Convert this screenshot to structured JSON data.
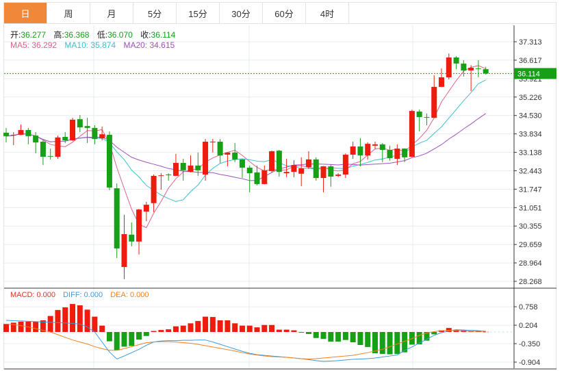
{
  "tabs": [
    {
      "label": "日",
      "active": true
    },
    {
      "label": "周"
    },
    {
      "label": "月"
    },
    {
      "label": "5分"
    },
    {
      "label": "15分"
    },
    {
      "label": "30分"
    },
    {
      "label": "60分"
    },
    {
      "label": "4时"
    }
  ],
  "ohlc_info": {
    "open_label": "开:",
    "open": "36.277",
    "high_label": "高:",
    "high": "36.368",
    "low_label": "低:",
    "low": "36.070",
    "close_label": "收:",
    "close": "36.114"
  },
  "ma_info": {
    "ma5": "MA5: 36.292",
    "ma10": "MA10: 35.874",
    "ma20": "MA20: 34.615"
  },
  "macd_info": {
    "macd": "MACD: 0.000",
    "diff": "DIFF: 0.000",
    "dea": "DEA: 0.000"
  },
  "colors": {
    "up": "#ee1c0e",
    "down": "#16a016",
    "ma5": "#e0608a",
    "ma10": "#3bbfd0",
    "ma20": "#a050c0",
    "macd": "#e03020",
    "diff": "#3a9ad9",
    "dea": "#f08020",
    "active_tab": "#f0883a"
  },
  "chart_data": [
    {
      "type": "candlestick",
      "y_ticks": [
        "37.313",
        "36.617",
        "35.921",
        "35.226",
        "34.530",
        "33.834",
        "33.138",
        "32.443",
        "31.747",
        "31.051",
        "30.355",
        "29.659",
        "28.964",
        "28.268"
      ],
      "ylim": [
        28.268,
        37.313
      ],
      "current_price": "36.114",
      "grid": true,
      "ohlc_fields": [
        "open",
        "high",
        "low",
        "close"
      ],
      "candles": [
        [
          33.88,
          34.06,
          33.51,
          33.75
        ],
        [
          33.79,
          33.9,
          33.41,
          33.8
        ],
        [
          33.8,
          34.19,
          33.78,
          33.98
        ],
        [
          33.98,
          34.06,
          33.44,
          33.75
        ],
        [
          33.77,
          33.9,
          33.1,
          33.51
        ],
        [
          33.54,
          33.59,
          32.66,
          32.97
        ],
        [
          33.0,
          33.28,
          32.87,
          32.98
        ],
        [
          32.97,
          33.77,
          32.89,
          33.7
        ],
        [
          33.72,
          33.9,
          33.49,
          33.59
        ],
        [
          33.59,
          34.44,
          33.57,
          34.37
        ],
        [
          34.39,
          34.55,
          33.9,
          34.08
        ],
        [
          34.13,
          34.44,
          33.49,
          34.06
        ],
        [
          34.06,
          34.16,
          33.44,
          33.64
        ],
        [
          33.67,
          34.11,
          33.59,
          33.82
        ],
        [
          33.8,
          33.93,
          31.71,
          31.81
        ],
        [
          31.78,
          31.96,
          29.15,
          29.51
        ],
        [
          28.81,
          30.78,
          28.35,
          30.05
        ],
        [
          30.03,
          30.49,
          29.59,
          29.77
        ],
        [
          29.77,
          31.0,
          29.28,
          30.98
        ],
        [
          30.9,
          31.27,
          30.54,
          31.16
        ],
        [
          31.22,
          32.3,
          30.88,
          32.25
        ],
        [
          32.25,
          32.35,
          31.73,
          32.27
        ],
        [
          32.3,
          32.35,
          32.07,
          32.28
        ],
        [
          32.25,
          33.08,
          32.24,
          32.74
        ],
        [
          32.74,
          32.89,
          32.07,
          32.46
        ],
        [
          32.4,
          33.02,
          32.38,
          32.64
        ],
        [
          32.64,
          33.13,
          32.25,
          32.46
        ],
        [
          32.3,
          33.64,
          32.07,
          33.54
        ],
        [
          33.52,
          33.64,
          33.13,
          33.54
        ],
        [
          33.54,
          33.64,
          32.74,
          33.02
        ],
        [
          33.05,
          33.14,
          32.61,
          33.13
        ],
        [
          33.13,
          33.49,
          32.77,
          32.87
        ],
        [
          32.87,
          32.89,
          32.17,
          32.56
        ],
        [
          32.56,
          32.64,
          31.63,
          32.35
        ],
        [
          32.38,
          32.64,
          31.89,
          31.94
        ],
        [
          31.94,
          32.64,
          31.93,
          32.46
        ],
        [
          32.43,
          33.2,
          32.38,
          33.18
        ],
        [
          33.2,
          33.23,
          32.22,
          32.4
        ],
        [
          32.35,
          32.89,
          32.2,
          32.4
        ],
        [
          32.4,
          32.84,
          32.2,
          32.66
        ],
        [
          32.33,
          32.95,
          31.86,
          32.53
        ],
        [
          32.58,
          33.18,
          32.51,
          32.87
        ],
        [
          32.87,
          32.95,
          32.07,
          32.17
        ],
        [
          32.17,
          32.62,
          31.63,
          32.61
        ],
        [
          32.61,
          32.69,
          31.84,
          32.22
        ],
        [
          32.25,
          32.35,
          32.2,
          32.3
        ],
        [
          32.3,
          33.1,
          32.17,
          33.05
        ],
        [
          33.05,
          33.54,
          32.89,
          33.36
        ],
        [
          33.36,
          33.67,
          32.61,
          33.02
        ],
        [
          33.02,
          33.52,
          32.87,
          33.46
        ],
        [
          33.39,
          33.54,
          33.26,
          33.44
        ],
        [
          33.44,
          33.49,
          32.77,
          33.23
        ],
        [
          33.23,
          33.39,
          32.82,
          32.92
        ],
        [
          32.89,
          33.44,
          32.66,
          33.28
        ],
        [
          33.28,
          33.29,
          32.77,
          32.95
        ],
        [
          32.97,
          34.75,
          32.96,
          34.7
        ],
        [
          34.68,
          34.75,
          33.93,
          34.47
        ],
        [
          34.47,
          34.6,
          34.16,
          34.46
        ],
        [
          34.44,
          36.05,
          34.43,
          35.61
        ],
        [
          35.61,
          36.31,
          35.6,
          35.97
        ],
        [
          35.97,
          36.87,
          35.89,
          36.72
        ],
        [
          36.72,
          36.77,
          36.28,
          36.49
        ],
        [
          36.49,
          36.62,
          36.0,
          36.23
        ],
        [
          36.23,
          36.43,
          35.45,
          36.33
        ],
        [
          36.31,
          36.62,
          35.97,
          36.3
        ],
        [
          36.277,
          36.368,
          36.07,
          36.114
        ]
      ],
      "moving_averages": [
        "MA5",
        "MA10",
        "MA20"
      ]
    },
    {
      "type": "macd",
      "y_ticks": [
        "0.758",
        "0.204",
        "-0.350",
        "-0.904"
      ],
      "ylim": [
        -1.0,
        0.96
      ],
      "histogram": [
        0.24,
        0.28,
        0.31,
        0.31,
        0.31,
        0.35,
        0.48,
        0.66,
        0.74,
        0.84,
        0.8,
        0.67,
        0.46,
        0.19,
        -0.28,
        -0.55,
        -0.44,
        -0.42,
        -0.23,
        -0.12,
        0.03,
        0.06,
        0.08,
        0.17,
        0.19,
        0.26,
        0.33,
        0.46,
        0.45,
        0.35,
        0.35,
        0.26,
        0.19,
        0.19,
        0.14,
        0.21,
        0.21,
        0.07,
        0.07,
        0.05,
        -0.01,
        -0.06,
        -0.18,
        -0.21,
        -0.29,
        -0.29,
        -0.24,
        -0.31,
        -0.39,
        -0.45,
        -0.64,
        -0.66,
        -0.67,
        -0.66,
        -0.61,
        -0.38,
        -0.37,
        -0.26,
        -0.07,
        0.05,
        0.12,
        0.07,
        0.05,
        0.03,
        0.02,
        0.01
      ],
      "diff": [
        0.35,
        0.34,
        0.33,
        0.32,
        0.31,
        0.3,
        0.29,
        0.28,
        0.27,
        0.26,
        0.24,
        0.15,
        0.0,
        -0.3,
        -0.6,
        -0.81,
        -0.72,
        -0.62,
        -0.52,
        -0.4,
        -0.3,
        -0.27,
        -0.26,
        -0.26,
        -0.25,
        -0.25,
        -0.24,
        -0.24,
        -0.3,
        -0.37,
        -0.44,
        -0.51,
        -0.58,
        -0.64,
        -0.68,
        -0.7,
        -0.72,
        -0.74,
        -0.76,
        -0.78,
        -0.8,
        -0.83,
        -0.86,
        -0.88,
        -0.87,
        -0.86,
        -0.84,
        -0.82,
        -0.81,
        -0.8,
        -0.78,
        -0.75,
        -0.72,
        -0.69,
        -0.55,
        -0.45,
        -0.33,
        -0.22,
        -0.1,
        -0.02,
        0.03,
        0.07,
        0.06,
        0.05,
        0.04,
        0.02
      ],
      "dea": [
        0.24,
        0.22,
        0.19,
        0.15,
        0.1,
        0.05,
        0.0,
        -0.08,
        -0.16,
        -0.24,
        -0.3,
        -0.36,
        -0.44,
        -0.5,
        -0.55,
        -0.55,
        -0.5,
        -0.44,
        -0.38,
        -0.32,
        -0.3,
        -0.29,
        -0.29,
        -0.3,
        -0.32,
        -0.34,
        -0.37,
        -0.41,
        -0.45,
        -0.49,
        -0.53,
        -0.57,
        -0.62,
        -0.66,
        -0.69,
        -0.72,
        -0.74,
        -0.75,
        -0.76,
        -0.78,
        -0.8,
        -0.81,
        -0.8,
        -0.78,
        -0.76,
        -0.74,
        -0.72,
        -0.7,
        -0.66,
        -0.62,
        -0.57,
        -0.52,
        -0.44,
        -0.36,
        -0.28,
        -0.2,
        -0.1,
        -0.03,
        0.01,
        0.04,
        0.05,
        0.04,
        0.03,
        0.02,
        0.02,
        0.02
      ]
    }
  ]
}
